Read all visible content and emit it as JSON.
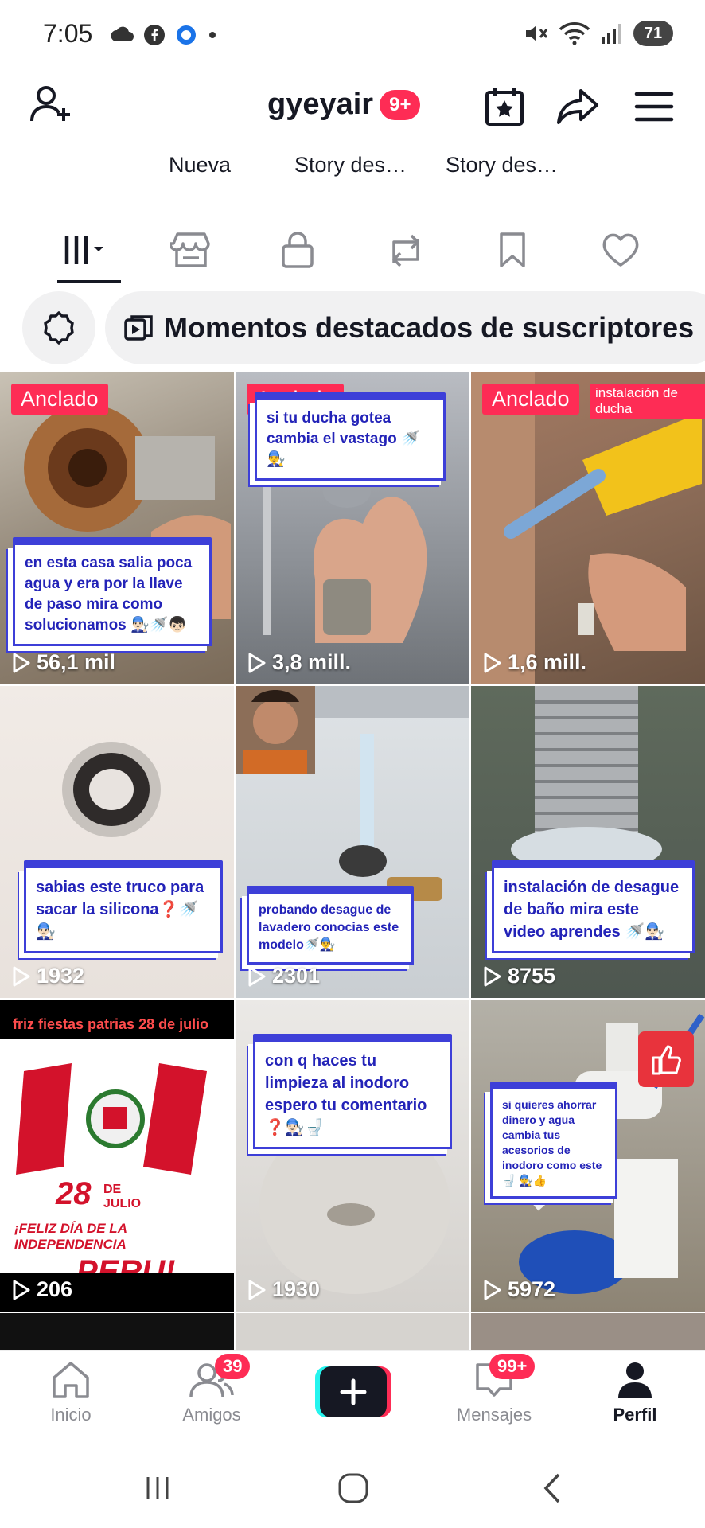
{
  "status_bar": {
    "time": "7:05",
    "battery": "71"
  },
  "header": {
    "username": "gyeyair",
    "notification_badge": "9+"
  },
  "stories": [
    "Nueva",
    "Story des…",
    "Story des…"
  ],
  "highlights": {
    "label": "Momentos destacados de suscriptores"
  },
  "videos": [
    {
      "pinned": "Anclado",
      "views": "56,1 mil",
      "caption": "en esta casa salia poca agua y era por la llave de paso mira como solucionamos 👨🏻‍🔧🚿👦🏻"
    },
    {
      "pinned": "Anclado",
      "views": "3,8 mill.",
      "caption": "si tu ducha gotea cambia el vastago 🚿 👨‍🔧"
    },
    {
      "pinned": "Anclado",
      "views": "1,6 mill.",
      "caption": "instalación de ducha"
    },
    {
      "views": "1932",
      "caption": "sabias este truco para sacar la silicona❓🚿 👨🏻‍🔧"
    },
    {
      "views": "2301",
      "caption": "probando desague de lavadero conocias este modelo🚿👨‍🔧"
    },
    {
      "views": "8755",
      "caption": "instalación de desague de baño mira este video aprendes 🚿👨🏻‍🔧"
    },
    {
      "views": "206",
      "top_text": "friz fiestas patrias 28 de julio",
      "date_line1": "28",
      "date_line2": "DE JULIO",
      "headline": "¡FELIZ DÍA DE LA INDEPENDENCIA",
      "country": "PERU!"
    },
    {
      "views": "1930",
      "caption": "con q haces tu limpieza al inodoro espero tu comentario ❓👨🏻‍🔧🚽"
    },
    {
      "views": "5972",
      "caption": "si quieres ahorrar dinero y agua cambia tus acesorios de inodoro como este 🚽 👨‍🔧👍"
    }
  ],
  "bottom_nav": {
    "home": "Inicio",
    "friends": "Amigos",
    "friends_badge": "39",
    "messages": "Mensajes",
    "messages_badge": "99+",
    "profile": "Perfil"
  },
  "colors": {
    "accent": "#fe2c55",
    "caption_blue": "#3d3fd8",
    "text": "#161823"
  }
}
